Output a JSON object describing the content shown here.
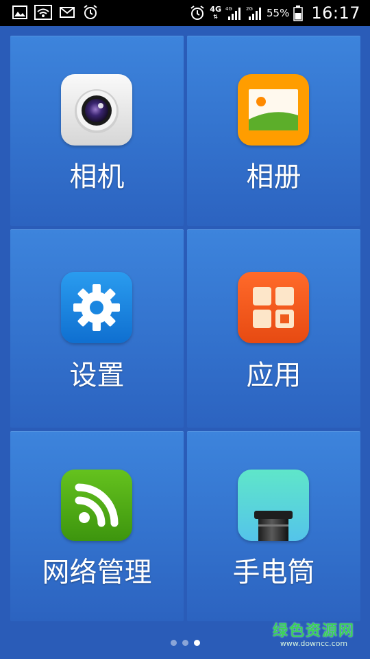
{
  "status_bar": {
    "network_4g": "4G",
    "signal1_tag": "4G",
    "signal2_tag": "2G",
    "battery_percent": "55%",
    "time": "16:17"
  },
  "apps": [
    {
      "label": "相机",
      "icon": "camera-icon"
    },
    {
      "label": "相册",
      "icon": "gallery-icon"
    },
    {
      "label": "设置",
      "icon": "settings-icon"
    },
    {
      "label": "应用",
      "icon": "apps-icon"
    },
    {
      "label": "网络管理",
      "icon": "wifi-icon"
    },
    {
      "label": "手电筒",
      "icon": "flashlight-icon"
    }
  ],
  "watermark": {
    "name": "绿色资源网",
    "url": "www.downcc.com"
  },
  "colors": {
    "background": "#2a5cb8",
    "tile": "#3372cd",
    "camera_bg": "#e8e8e8",
    "gallery_bg": "#ff9d00",
    "settings_bg": "#1a86e0",
    "apps_bg": "#f2581e",
    "wifi_bg": "#4aa413",
    "flashlight_bg": "#57dfd0"
  }
}
